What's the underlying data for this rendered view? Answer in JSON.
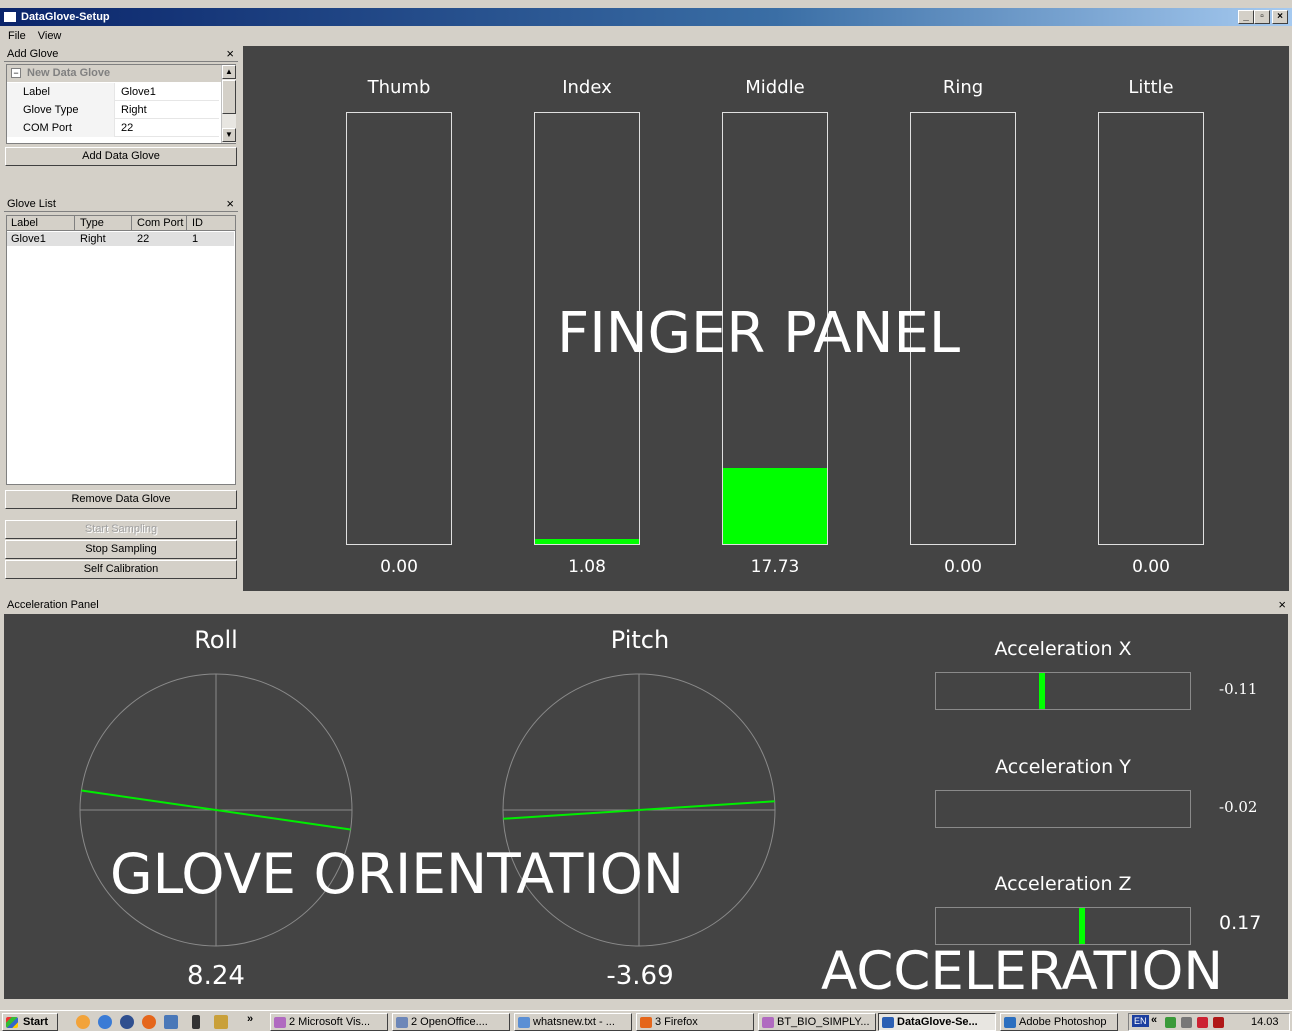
{
  "window": {
    "title": "DataGlove-Setup",
    "controls": [
      "_",
      "▫",
      "×"
    ]
  },
  "menu": {
    "items": [
      "File",
      "View"
    ]
  },
  "add_glove": {
    "title": "Add Glove",
    "group": "New Data Glove",
    "props": [
      {
        "key": "Label",
        "value": "Glove1"
      },
      {
        "key": "Glove Type",
        "value": "Right"
      },
      {
        "key": "COM Port",
        "value": "22"
      }
    ],
    "button": "Add Data Glove"
  },
  "glove_list": {
    "title": "Glove List",
    "columns": [
      "Label",
      "Type",
      "Com Port",
      "ID"
    ],
    "rows": [
      {
        "label": "Glove1",
        "type": "Right",
        "port": "22",
        "id": "1"
      }
    ],
    "remove_button": "Remove Data Glove",
    "start_button": "Start Sampling",
    "stop_button": "Stop Sampling",
    "calib_button": "Self Calibration"
  },
  "finger_panel": {
    "overlay": "FINGER PANEL",
    "fingers": [
      {
        "name": "Thumb",
        "value": "0.00",
        "fill": 0.0
      },
      {
        "name": "Index",
        "value": "1.08",
        "fill": 0.0108
      },
      {
        "name": "Middle",
        "value": "17.73",
        "fill": 0.1773
      },
      {
        "name": "Ring",
        "value": "0.00",
        "fill": 0.0
      },
      {
        "name": "Little",
        "value": "0.00",
        "fill": 0.0
      }
    ],
    "fill_color": "#00ff00"
  },
  "accel_panel": {
    "title": "Acceleration Panel",
    "roll": {
      "name": "Roll",
      "value": "8.24"
    },
    "pitch": {
      "name": "Pitch",
      "value": "-3.69"
    },
    "orientation_overlay": "GLOVE ORIENTATION",
    "acceleration_overlay": "ACCELERATION",
    "accels": [
      {
        "name": "Acceleration X",
        "value": "-0.11",
        "level": -0.11
      },
      {
        "name": "Acceleration Y",
        "value": "-0.02",
        "level": -0.02
      },
      {
        "name": "Acceleration Z",
        "value": "0.17",
        "level": 0.17
      }
    ]
  },
  "taskbar": {
    "start": "Start",
    "items": [
      "2 Microsoft Vis...",
      "2 OpenOffice....",
      "whatsnew.txt - ...",
      "3 Firefox",
      "BT_BIO_SIMPLY...",
      "DataGlove-Se...",
      "Adobe Photoshop"
    ],
    "lang": "EN",
    "clock": "14.03"
  }
}
